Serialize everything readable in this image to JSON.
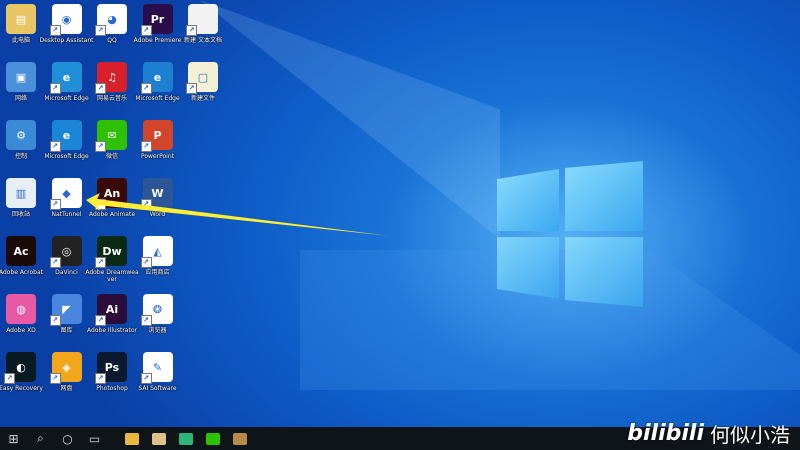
{
  "desktop": {
    "icons": [
      {
        "label": "此电脑",
        "color": "#e8c565",
        "glyph": "▤"
      },
      {
        "label": "Desktop Assistant",
        "color": "#ffffff",
        "glyph": "◉"
      },
      {
        "label": "QQ",
        "color": "#ffffff",
        "glyph": "◕"
      },
      {
        "label": "Adobe Premiere",
        "color": "#2a0d4a",
        "glyph": "Pr"
      },
      {
        "label": "新建 文本文档",
        "color": "#f2f2f2",
        "glyph": ""
      },
      {
        "label": "网络",
        "color": "#4a8fd9",
        "glyph": "▣"
      },
      {
        "label": "Microsoft Edge",
        "color": "#1f8fd8",
        "glyph": "e"
      },
      {
        "label": "网易云音乐",
        "color": "#d8202a",
        "glyph": "♫"
      },
      {
        "label": "Microsoft Edge",
        "color": "#1d7fd1",
        "glyph": "e"
      },
      {
        "label": "新建文件",
        "color": "#f4f0d6",
        "glyph": "▢"
      },
      {
        "label": "控制",
        "color": "#3a8ad6",
        "glyph": "⚙"
      },
      {
        "label": "Microsoft Edge",
        "color": "#1b86d8",
        "glyph": "e"
      },
      {
        "label": "微信",
        "color": "#2dc100",
        "glyph": "✉"
      },
      {
        "label": "PowerPoint",
        "color": "#d2452a",
        "glyph": "P"
      },
      {
        "label": "",
        "color": "transparent",
        "glyph": ""
      },
      {
        "label": "回收站",
        "color": "#e8eef5",
        "glyph": "▥"
      },
      {
        "label": "NatTunnel",
        "color": "#ffffff",
        "glyph": "◆"
      },
      {
        "label": "Adobe Animate",
        "color": "#3a0a0a",
        "glyph": "An"
      },
      {
        "label": "Word",
        "color": "#2b5797",
        "glyph": "W"
      },
      {
        "label": "",
        "color": "transparent",
        "glyph": ""
      },
      {
        "label": "Adobe Acrobat",
        "color": "#1a0a0a",
        "glyph": "Ac"
      },
      {
        "label": "DaVinci",
        "color": "#222222",
        "glyph": "◎"
      },
      {
        "label": "Adobe Dreamweaver",
        "color": "#0a2a14",
        "glyph": "Dw"
      },
      {
        "label": "应用商店",
        "color": "#ffffff",
        "glyph": "◭"
      },
      {
        "label": "",
        "color": "transparent",
        "glyph": ""
      },
      {
        "label": "Adobe XD",
        "color": "#e85aa6",
        "glyph": "◍"
      },
      {
        "label": "图库",
        "color": "#4a86e0",
        "glyph": "◤"
      },
      {
        "label": "Adobe Illustrator",
        "color": "#2a0d3a",
        "glyph": "Ai"
      },
      {
        "label": "浏览器",
        "color": "#ffffff",
        "glyph": "❂"
      },
      {
        "label": "",
        "color": "transparent",
        "glyph": ""
      },
      {
        "label": "Easy Recovery",
        "color": "#0a1a22",
        "glyph": "◐"
      },
      {
        "label": "网盘",
        "color": "#f2a61c",
        "glyph": "◈"
      },
      {
        "label": "Photoshop",
        "color": "#0a1a2e",
        "glyph": "Ps"
      },
      {
        "label": "SAI Software",
        "color": "#ffffff",
        "glyph": "✎"
      },
      {
        "label": "",
        "color": "transparent",
        "glyph": ""
      }
    ]
  },
  "taskbar": {
    "start_icon": "⊞",
    "search_icon": "⌕",
    "cortana_icon": "○",
    "taskview_icon": "▭",
    "apps": [
      {
        "name": "file-explorer",
        "color": "#e8b93a"
      },
      {
        "name": "store",
        "color": "#dfc18a"
      },
      {
        "name": "edge",
        "color": "#2fb57a"
      },
      {
        "name": "wechat",
        "color": "#2dc100"
      },
      {
        "name": "archive",
        "color": "#b88a4a"
      }
    ]
  },
  "watermark": {
    "logo": "bilibili",
    "author": "何似小浩"
  },
  "colors": {
    "arrow": "#ffee33",
    "accent": "#0e5cc7"
  }
}
